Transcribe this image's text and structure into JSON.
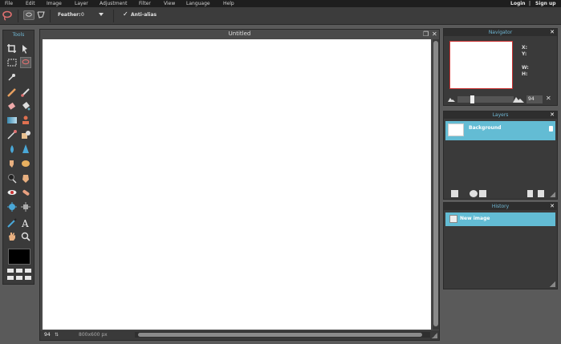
{
  "menubar": {
    "items": [
      "File",
      "Edit",
      "Image",
      "Layer",
      "Adjustment",
      "Filter",
      "View",
      "Language",
      "Help"
    ],
    "login": "Login",
    "separator": "|",
    "signup": "Sign up"
  },
  "options": {
    "feather_label": "Feather:",
    "feather_value": "0",
    "antialias_label": "Anti-alias",
    "antialias_checked": true
  },
  "tools": {
    "title": "Tools",
    "items": [
      "crop-icon",
      "move-icon",
      "marquee-icon",
      "lasso-icon",
      "wand-icon",
      "pencil-icon",
      "brush-icon",
      "eraser-icon",
      "bucket-icon",
      "gradient-icon",
      "stamp-icon",
      "color-replace-icon",
      "drawing-icon",
      "blur-icon",
      "sharpen-icon",
      "smudge-icon",
      "sponge-icon",
      "dodge-icon",
      "burn-icon",
      "redeye-icon",
      "spot-heal-icon",
      "bloat-icon",
      "pinch-icon",
      "picker-icon",
      "type-icon",
      "hand-icon",
      "zoom-icon"
    ]
  },
  "document": {
    "title": "Untitled",
    "zoom": "94",
    "dimensions": "800x600 px"
  },
  "navigator": {
    "title": "Navigator",
    "x_label": "X:",
    "y_label": "Y:",
    "w_label": "W:",
    "h_label": "H:",
    "zoom": "94"
  },
  "layers": {
    "title": "Layers",
    "items": [
      {
        "name": "Background"
      }
    ]
  },
  "history": {
    "title": "History",
    "items": [
      {
        "name": "New image"
      }
    ]
  },
  "colors": {
    "accent": "#63bcd4",
    "panel_title": "#6fb7d4"
  }
}
